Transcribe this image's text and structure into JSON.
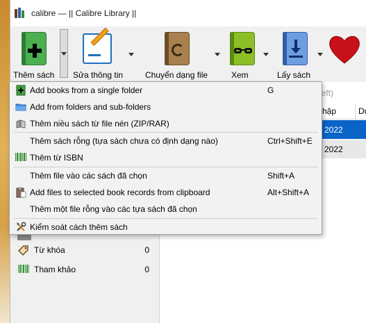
{
  "window": {
    "title": "calibre — || Calibre Library ||"
  },
  "toolbar": {
    "add_books_label": "Thêm sách",
    "edit_metadata_label": "Sửa thông tin",
    "convert_label": "Chuyển dạng file",
    "view_label": "Xem",
    "get_books_label": "Lấy sách"
  },
  "library": {
    "search_hint": "left)",
    "col_date": "hập",
    "col_next": "Du",
    "row1_date": "2022",
    "row2_date": "2022",
    "colors": {
      "selected_row": "#0a64c8",
      "row_alt": "#e8e8e8"
    }
  },
  "tag_browser": {
    "tags_label": "Từ khóa",
    "tags_count": "0",
    "identifiers_label": "Tham khảo",
    "identifiers_count": "0"
  },
  "add_menu": {
    "items": [
      {
        "label": "Add books from a single folder",
        "shortcut": "G",
        "icon": "add-book-icon"
      },
      {
        "label": "Add from folders and sub-folders",
        "shortcut": "",
        "icon": "folder-icon"
      },
      {
        "label": "Thêm niều sách từ file nén (ZIP/RAR)",
        "shortcut": "",
        "icon": "archive-icon"
      },
      {
        "label": "Thêm sách rỗng (tựa sách chưa có định dạng nào)",
        "shortcut": "Ctrl+Shift+E",
        "icon": ""
      },
      {
        "label": "Thêm từ ISBN",
        "shortcut": "",
        "icon": "barcode-icon"
      },
      {
        "label": "Thêm file vào các sách đã chọn",
        "shortcut": "Shift+A",
        "icon": ""
      },
      {
        "label": "Add files to selected book records from clipboard",
        "shortcut": "Alt+Shift+A",
        "icon": "clipboard-icon"
      },
      {
        "label": "Thêm một file rỗng vào các tựa sách đã chọn",
        "shortcut": "",
        "icon": ""
      },
      {
        "label": "Kiểm soát cách thêm sách",
        "shortcut": "",
        "icon": "tools-icon"
      }
    ]
  }
}
